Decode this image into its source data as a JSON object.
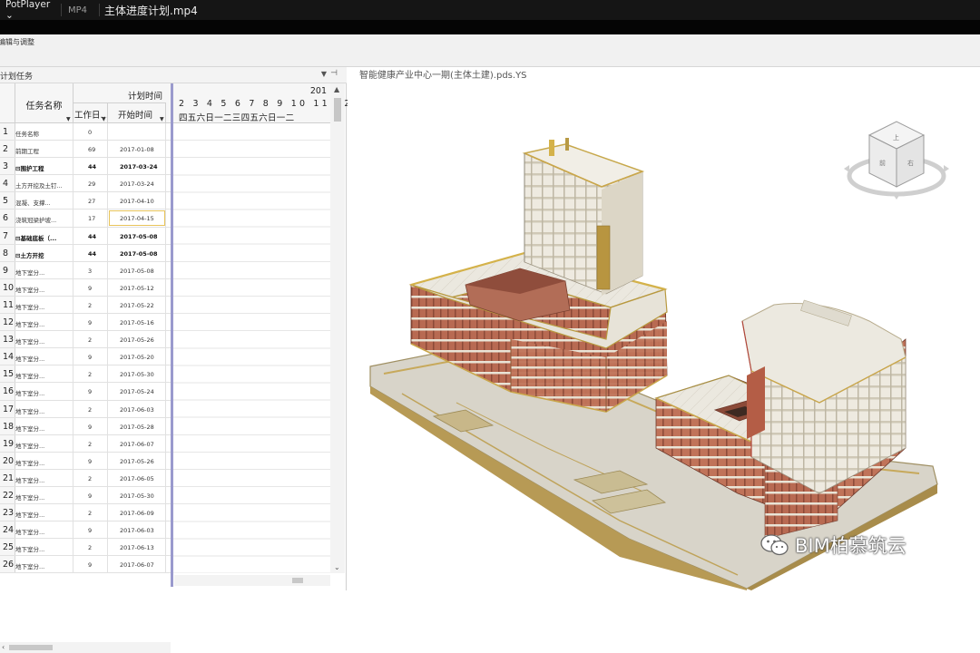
{
  "titlebar": {
    "app": "PotPlayer",
    "format": "MP4",
    "filename": "主体进度计划.mp4"
  },
  "toolbar": {
    "label": "编辑与调整"
  },
  "panel": {
    "title": "计划任务",
    "columns": {
      "task_name": "任务名称",
      "plan_time": "计划时间",
      "work_days": "工作日",
      "start_time": "开始时间"
    },
    "timeline": {
      "year": "201",
      "days": "2 3 4 5 6 7 8 9 10 11 12 13 14",
      "weekdays": "四五六日一二三四五六日一二"
    },
    "rows": [
      {
        "n": "1",
        "name": "任务名称",
        "work": "0",
        "start": "",
        "bold": false
      },
      {
        "n": "2",
        "name": "前期工程",
        "work": "69",
        "start": "2017-01-08",
        "bold": false
      },
      {
        "n": "3",
        "name": "⊟围护工程",
        "work": "44",
        "start": "2017-03-24",
        "bold": true
      },
      {
        "n": "4",
        "name": "土方开挖及土钉...",
        "work": "29",
        "start": "2017-03-24",
        "bold": false
      },
      {
        "n": "5",
        "name": "混凝、支撑...",
        "work": "27",
        "start": "2017-04-10",
        "bold": false
      },
      {
        "n": "6",
        "name": "浇筑冠梁护坡...",
        "work": "17",
        "start": "2017-04-15",
        "bold": false
      },
      {
        "n": "7",
        "name": "⊟基础底板（...",
        "work": "44",
        "start": "2017-05-08",
        "bold": true
      },
      {
        "n": "8",
        "name": "⊟土方开挖",
        "work": "44",
        "start": "2017-05-08",
        "bold": true
      },
      {
        "n": "9",
        "name": "地下室分...",
        "work": "3",
        "start": "2017-05-08",
        "bold": false
      },
      {
        "n": "10",
        "name": "地下室分...",
        "work": "9",
        "start": "2017-05-12",
        "bold": false
      },
      {
        "n": "11",
        "name": "地下室分...",
        "work": "2",
        "start": "2017-05-22",
        "bold": false
      },
      {
        "n": "12",
        "name": "地下室分...",
        "work": "9",
        "start": "2017-05-16",
        "bold": false
      },
      {
        "n": "13",
        "name": "地下室分...",
        "work": "2",
        "start": "2017-05-26",
        "bold": false
      },
      {
        "n": "14",
        "name": "地下室分...",
        "work": "9",
        "start": "2017-05-20",
        "bold": false
      },
      {
        "n": "15",
        "name": "地下室分...",
        "work": "2",
        "start": "2017-05-30",
        "bold": false
      },
      {
        "n": "16",
        "name": "地下室分...",
        "work": "9",
        "start": "2017-05-24",
        "bold": false
      },
      {
        "n": "17",
        "name": "地下室分...",
        "work": "2",
        "start": "2017-06-03",
        "bold": false
      },
      {
        "n": "18",
        "name": "地下室分...",
        "work": "9",
        "start": "2017-05-28",
        "bold": false
      },
      {
        "n": "19",
        "name": "地下室分...",
        "work": "2",
        "start": "2017-06-07",
        "bold": false
      },
      {
        "n": "20",
        "name": "地下室分...",
        "work": "9",
        "start": "2017-05-26",
        "bold": false
      },
      {
        "n": "21",
        "name": "地下室分...",
        "work": "2",
        "start": "2017-06-05",
        "bold": false
      },
      {
        "n": "22",
        "name": "地下室分...",
        "work": "9",
        "start": "2017-05-30",
        "bold": false
      },
      {
        "n": "23",
        "name": "地下室分...",
        "work": "2",
        "start": "2017-06-09",
        "bold": false
      },
      {
        "n": "24",
        "name": "地下室分...",
        "work": "9",
        "start": "2017-06-03",
        "bold": false
      },
      {
        "n": "25",
        "name": "地下室分...",
        "work": "2",
        "start": "2017-06-13",
        "bold": false
      },
      {
        "n": "26",
        "name": "地下室分...",
        "work": "9",
        "start": "2017-06-07",
        "bold": false
      }
    ]
  },
  "viewport": {
    "title": "智能健康产业中心一期(主体土建).pds.YS",
    "viewcube": {
      "top": "上",
      "front": "前",
      "right": "右"
    }
  },
  "watermark": "BIM柏慕筑云",
  "colors": {
    "concrete": "#e6e2d6",
    "brick": "#a85a43",
    "beam_yellow": "#c9a64b",
    "splitter": "#9a9acd"
  }
}
